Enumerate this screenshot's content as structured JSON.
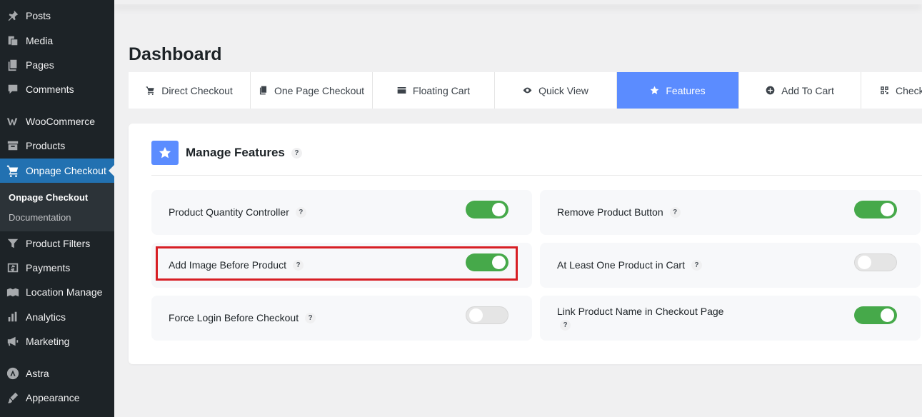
{
  "sidebar": {
    "items": [
      {
        "label": "Posts",
        "icon": "pin-icon"
      },
      {
        "label": "Media",
        "icon": "media-icon"
      },
      {
        "label": "Pages",
        "icon": "pages-icon"
      },
      {
        "label": "Comments",
        "icon": "comment-icon"
      },
      {
        "label": "WooCommerce",
        "icon": "woo-icon"
      },
      {
        "label": "Products",
        "icon": "archive-icon"
      },
      {
        "label": "Onpage Checkout",
        "icon": "cart-icon"
      },
      {
        "label": "Product Filters",
        "icon": "filter-icon"
      },
      {
        "label": "Payments",
        "icon": "dollar-icon"
      },
      {
        "label": "Location Manage",
        "icon": "location-icon"
      },
      {
        "label": "Analytics",
        "icon": "bar-chart-icon"
      },
      {
        "label": "Marketing",
        "icon": "megaphone-icon"
      },
      {
        "label": "Astra",
        "icon": "astra-icon"
      },
      {
        "label": "Appearance",
        "icon": "brush-icon"
      }
    ],
    "submenu": [
      "Onpage Checkout",
      "Documentation"
    ]
  },
  "page": {
    "title": "Dashboard"
  },
  "tabs": [
    {
      "label": "Direct Checkout",
      "icon": "cart-icon"
    },
    {
      "label": "One Page Checkout",
      "icon": "copy-icon"
    },
    {
      "label": "Floating Cart",
      "icon": "card-icon"
    },
    {
      "label": "Quick View",
      "icon": "eye-icon"
    },
    {
      "label": "Features",
      "icon": "star-icon"
    },
    {
      "label": "Add To Cart",
      "icon": "plus-circle-icon"
    },
    {
      "label": "Check",
      "icon": "qr-icon"
    }
  ],
  "panel": {
    "title": "Manage Features",
    "help": "?",
    "features": [
      {
        "label": "Product Quantity Controller",
        "enabled": true
      },
      {
        "label": "Remove Product Button",
        "enabled": true
      },
      {
        "label": "Add Image Before Product",
        "enabled": true
      },
      {
        "label": "At Least One Product in Cart",
        "enabled": false
      },
      {
        "label": "Force Login Before Checkout",
        "enabled": false
      },
      {
        "label": "Link Product Name in Checkout Page",
        "enabled": true
      }
    ]
  },
  "colors": {
    "sidebar_bg": "#1d2327",
    "active_menu": "#2271b1",
    "tab_active": "#5b8cff",
    "toggle_on": "#46a94a",
    "highlight": "#d71e24"
  }
}
